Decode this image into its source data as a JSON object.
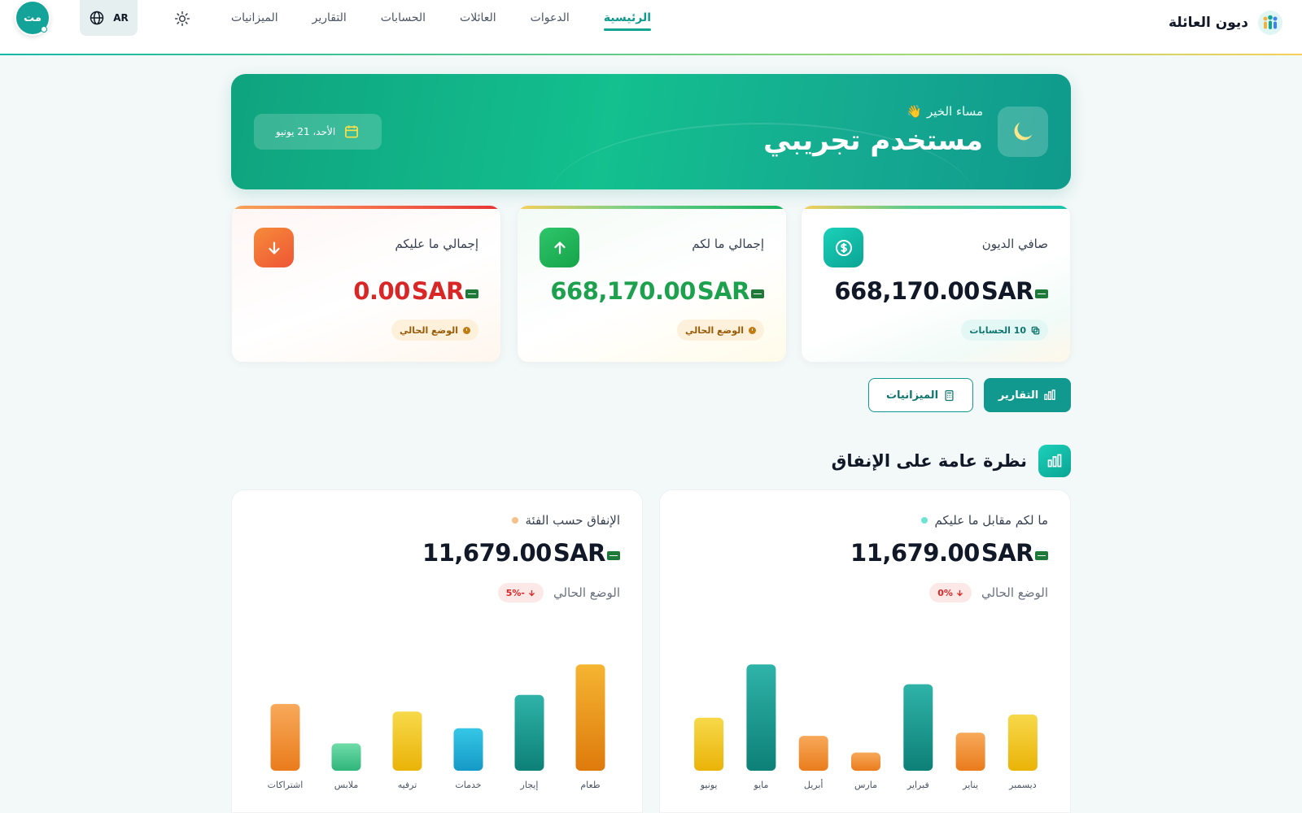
{
  "app": {
    "name": "ديون العائلة",
    "icons": {
      "logo": "family-icon",
      "theme": "sun-icon",
      "language": "globe-icon"
    }
  },
  "nav": {
    "items": [
      {
        "label": "الرئيسية",
        "active": true
      },
      {
        "label": "الدعوات",
        "active": false
      },
      {
        "label": "العائلات",
        "active": false
      },
      {
        "label": "الحسابات",
        "active": false
      },
      {
        "label": "التقارير",
        "active": false
      },
      {
        "label": "الميزانيات",
        "active": false
      }
    ]
  },
  "header": {
    "language_label": "AR",
    "avatar_initials": "مت"
  },
  "banner": {
    "greeting": "مساء الخير",
    "greeting_emoji": "👋",
    "user_name": "مستخدم تجريبي",
    "date": "الأحد، 21 يونيو",
    "icon": "moon-icon"
  },
  "stats": {
    "net": {
      "label": "صافي الديون",
      "amount": "668,170.00",
      "currency": "SAR",
      "chip": "10 الحسابات",
      "icon": "dollar-icon"
    },
    "owed_to_you": {
      "label": "إجمالي ما لكم",
      "amount": "668,170.00",
      "currency": "SAR",
      "chip": "الوضع الحالي",
      "icon": "arrow-up-icon"
    },
    "owed_by_you": {
      "label": "إجمالي ما عليكم",
      "amount": "0.00",
      "currency": "SAR",
      "chip": "الوضع الحالي",
      "icon": "arrow-down-icon"
    }
  },
  "actions": {
    "reports_label": "التقارير",
    "budgets_label": "الميزانيات"
  },
  "section": {
    "title": "نظرة عامة على الإنفاق"
  },
  "charts": {
    "balance": {
      "title": "ما لكم مقابل ما عليكم",
      "amount": "11,679.00",
      "currency": "SAR",
      "status_label": "الوضع الحالي",
      "trend": "0%"
    },
    "category": {
      "title": "الإنفاق حسب الفئة",
      "amount": "11,679.00",
      "currency": "SAR",
      "status_label": "الوضع الحالي",
      "trend": "-5%"
    }
  },
  "colors": {
    "primary": "#12998f",
    "teal_bar": "#1b9e94",
    "orange_bar": "#f39a3a",
    "yellow_bar": "#f3cc2c",
    "green_bar": "#5fd39d",
    "cyan_bar": "#25b8db",
    "negative": "#d92626",
    "positive": "#1ea14f"
  },
  "chart_data": [
    {
      "type": "bar",
      "categories": [
        "ديسمبر",
        "يناير",
        "فبراير",
        "مارس",
        "أبريل",
        "مايو",
        "يونيو"
      ],
      "values": [
        37,
        25,
        57,
        12,
        23,
        70,
        35
      ],
      "colors": [
        "yellow",
        "orange",
        "teal",
        "orange",
        "orange",
        "teal",
        "yellow"
      ],
      "ylim": [
        0,
        75
      ]
    },
    {
      "type": "bar",
      "categories": [
        "طعام",
        "إيجار",
        "خدمات",
        "ترفيه",
        "ملابس",
        "اشتراكات"
      ],
      "values": [
        70,
        50,
        28,
        39,
        18,
        44
      ],
      "colors": [
        "orange-deep",
        "teal",
        "cyan",
        "yellow",
        "green",
        "orange"
      ],
      "ylim": [
        0,
        75
      ]
    }
  ]
}
